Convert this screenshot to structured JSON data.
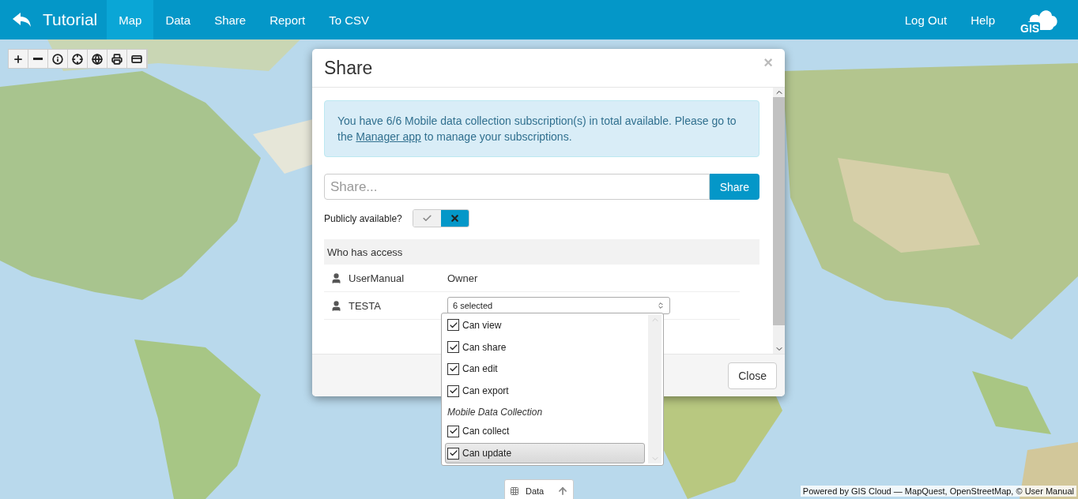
{
  "header": {
    "title": "Tutorial",
    "nav": [
      {
        "label": "Map",
        "selected": true
      },
      {
        "label": "Data",
        "selected": false
      },
      {
        "label": "Share",
        "selected": false
      },
      {
        "label": "Report",
        "selected": false
      },
      {
        "label": "To CSV",
        "selected": false
      }
    ],
    "links": [
      "Log Out",
      "Help"
    ],
    "logo": "GIS"
  },
  "dialog": {
    "title": "Share",
    "close": "×",
    "alert": {
      "before": "You have 6/6 Mobile data collection subscription(s) in total available. Please go to the ",
      "link": "Manager app",
      "after": " to manage your subscriptions."
    },
    "share_field": {
      "placeholder": "Share..."
    },
    "share_button": "Share",
    "public": {
      "label": "Publicly available?",
      "on": false
    },
    "access": {
      "heading": "Who has access",
      "rows": [
        {
          "user": "UserManual",
          "role": "Owner"
        },
        {
          "user": "TESTA",
          "select": "6 selected"
        }
      ]
    },
    "permissions": [
      {
        "kind": "option",
        "label": "Can view",
        "checked": true,
        "highlighted": false
      },
      {
        "kind": "option",
        "label": "Can share",
        "checked": true,
        "highlighted": false
      },
      {
        "kind": "option",
        "label": "Can edit",
        "checked": true,
        "highlighted": false
      },
      {
        "kind": "option",
        "label": "Can export",
        "checked": true,
        "highlighted": false
      },
      {
        "kind": "group",
        "label": "Mobile Data Collection"
      },
      {
        "kind": "option",
        "label": "Can collect",
        "checked": true,
        "highlighted": false
      },
      {
        "kind": "option",
        "label": "Can update",
        "checked": true,
        "highlighted": true
      }
    ],
    "footer_button": "Close"
  },
  "data_tab": {
    "label": "Data"
  },
  "attribution": "Powered by GIS Cloud — MapQuest, OpenStreetMap, © User Manual"
}
